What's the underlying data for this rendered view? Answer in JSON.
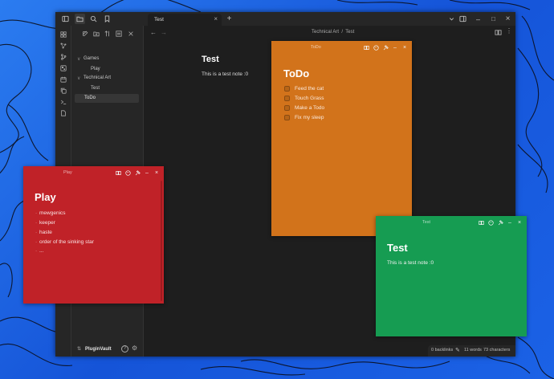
{
  "colors": {
    "desktop": "#1d6fe0",
    "app_bg": "#1e1e1e",
    "panel_bg": "#262626",
    "note_orange": "#d2731b",
    "note_red": "#c02228",
    "note_green": "#169c52"
  },
  "tab": {
    "title": "Test",
    "close": "×"
  },
  "titlebar": {
    "new_tab": "+",
    "minimize": "–",
    "maximize": "□",
    "close": "×"
  },
  "nav": {
    "back": "←",
    "forward": "→",
    "breadcrumb": "Technical Art  /  Test"
  },
  "sidebar": {
    "tree": [
      {
        "label": "Games",
        "chevron": "∨"
      },
      {
        "label": "Play"
      },
      {
        "label": "Technical Art",
        "chevron": "∨"
      },
      {
        "label": "Test"
      },
      {
        "label": "ToDo"
      }
    ],
    "vault_name": "PluginVault"
  },
  "editor": {
    "title": "Test",
    "body": "This is a test note :0"
  },
  "status": {
    "backlinks": "0 backlinks",
    "words": "11 words",
    "characters": "73 characters"
  },
  "notes": {
    "todo": {
      "header": "ToDo",
      "title": "ToDo",
      "items": [
        "Feed the cat",
        "Touch Grass",
        "Make a Todo",
        "Fix my sleep"
      ],
      "close": "×"
    },
    "play": {
      "header": "Play",
      "title": "Play",
      "items": [
        "mewgenics",
        "keeper",
        "haste",
        "order of the sinking star",
        "..."
      ],
      "close": "×"
    },
    "test": {
      "header": "Test",
      "title": "Test",
      "body": "This is a test note :0",
      "close": "×"
    }
  }
}
